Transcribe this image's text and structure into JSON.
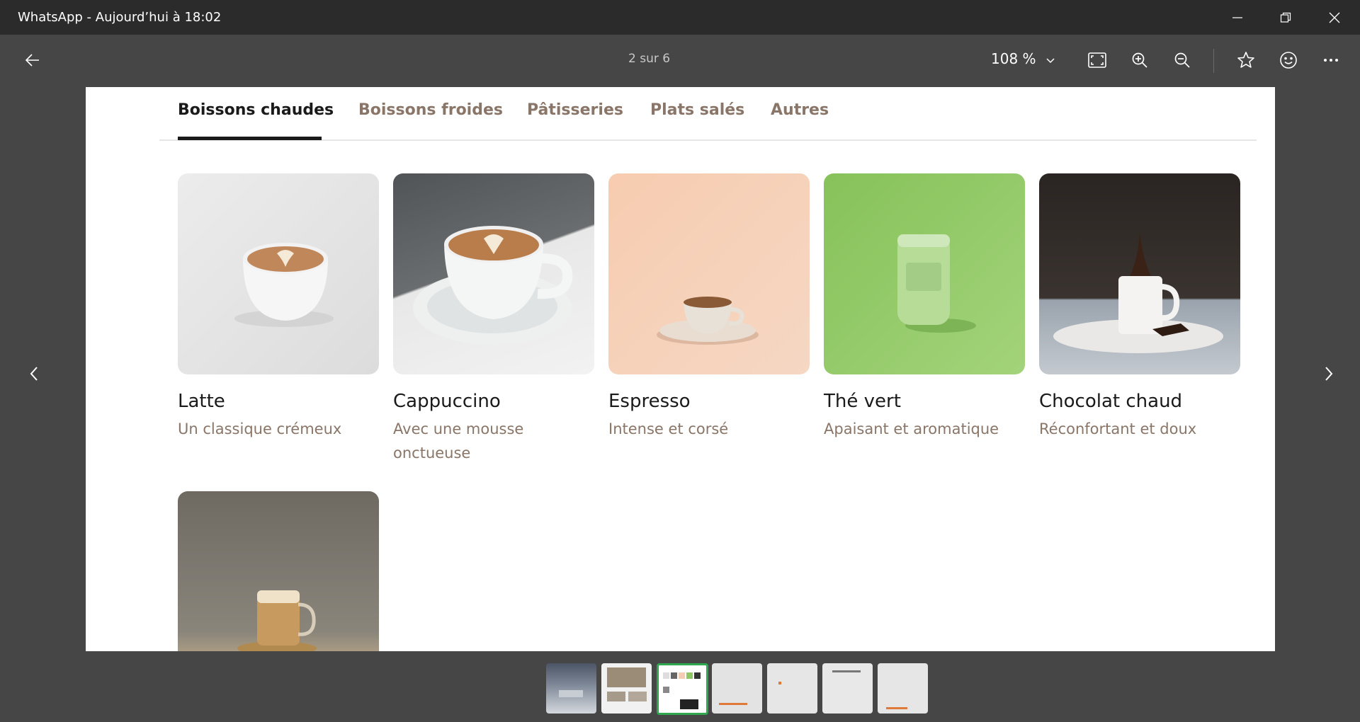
{
  "window": {
    "title": "WhatsApp - Aujourd’hui à 18:02"
  },
  "toolbar": {
    "counter": "2 sur 6",
    "zoom": "108 %",
    "icons": [
      "back-arrow-icon",
      "chevron-down-icon",
      "fit-screen-icon",
      "zoom-in-icon",
      "zoom-out-icon",
      "star-icon",
      "emoji-icon",
      "more-icon"
    ]
  },
  "menu": {
    "tabs": [
      {
        "label": "Boissons chaudes",
        "active": true
      },
      {
        "label": "Boissons froides",
        "active": false
      },
      {
        "label": "Pâtisseries",
        "active": false
      },
      {
        "label": "Plats salés",
        "active": false
      },
      {
        "label": "Autres",
        "active": false
      }
    ],
    "items": [
      {
        "name": "Latte",
        "description": "Un classique crémeux"
      },
      {
        "name": "Cappuccino",
        "description": "Avec une mousse onctueuse"
      },
      {
        "name": "Espresso",
        "description": "Intense et corsé"
      },
      {
        "name": "Thé vert",
        "description": "Apaisant et aromatique"
      },
      {
        "name": "Chocolat chaud",
        "description": "Réconfortant et doux"
      },
      {
        "name": "",
        "description": ""
      }
    ]
  },
  "colors": {
    "titlebar": "#2b2b2b",
    "background": "#464646",
    "tab_inactive": "#8a7668",
    "thumb_active_border": "#2fa84f"
  },
  "filmstrip": {
    "count": 7,
    "active_index": 2
  }
}
